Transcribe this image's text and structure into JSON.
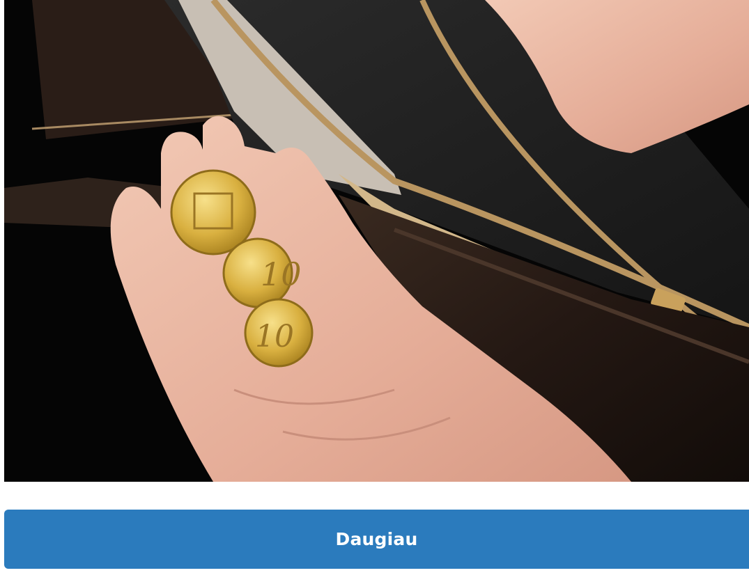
{
  "photo": {
    "icon": "wallet-coins-photo"
  },
  "more_button": {
    "label": "Daugiau",
    "color": "#2b7bbd"
  }
}
